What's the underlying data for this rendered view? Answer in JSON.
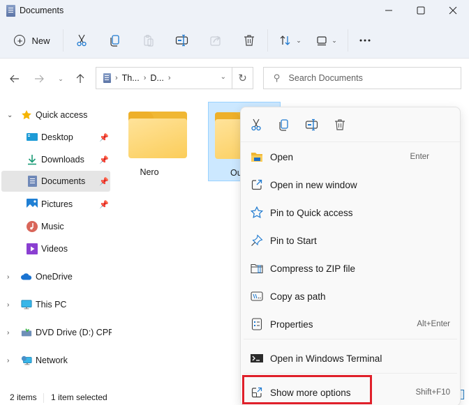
{
  "window": {
    "title": "Documents",
    "controls": {
      "minimize": "minimize-icon",
      "maximize": "maximize-icon",
      "close": "close-icon"
    }
  },
  "toolbar": {
    "new_label": "New",
    "buttons": [
      {
        "name": "cut",
        "icon": "scissors-icon",
        "enabled": true
      },
      {
        "name": "copy",
        "icon": "copy-icon",
        "enabled": true
      },
      {
        "name": "paste",
        "icon": "paste-icon",
        "enabled": false
      },
      {
        "name": "rename",
        "icon": "rename-icon",
        "enabled": true
      },
      {
        "name": "share",
        "icon": "share-icon",
        "enabled": false
      },
      {
        "name": "delete",
        "icon": "trash-icon",
        "enabled": true
      },
      {
        "name": "sort",
        "icon": "sort-icon",
        "has_dropdown": true
      },
      {
        "name": "view",
        "icon": "view-icon",
        "has_dropdown": true
      },
      {
        "name": "more",
        "icon": "more-icon"
      }
    ]
  },
  "navigation": {
    "back": "back-arrow-icon",
    "forward": "forward-arrow-icon",
    "recent": "chevron-down-icon",
    "up": "up-arrow-icon"
  },
  "address": {
    "crumbs": [
      "Th...",
      "D..."
    ]
  },
  "search": {
    "placeholder": "Search Documents"
  },
  "sidebar": {
    "items": [
      {
        "label": "Quick access",
        "expand": "expanded",
        "pinned": false
      },
      {
        "label": "Desktop",
        "pinned": true
      },
      {
        "label": "Downloads",
        "pinned": true
      },
      {
        "label": "Documents",
        "pinned": true,
        "selected": true
      },
      {
        "label": "Pictures",
        "pinned": true
      },
      {
        "label": "Music",
        "pinned": false
      },
      {
        "label": "Videos",
        "pinned": false
      },
      {
        "label": "OneDrive",
        "expand": "collapsed"
      },
      {
        "label": "This PC",
        "expand": "collapsed"
      },
      {
        "label": "DVD Drive (D:) CPRA",
        "expand": "collapsed"
      },
      {
        "label": "Network",
        "expand": "collapsed"
      }
    ]
  },
  "content": {
    "folders": [
      {
        "name": "Nero",
        "selected": false
      },
      {
        "name": "Ou",
        "selected": true
      }
    ]
  },
  "status": {
    "items": "2 items",
    "selected": "1 item selected"
  },
  "context_menu": {
    "quick_actions": [
      "cut",
      "copy",
      "rename",
      "delete"
    ],
    "items": [
      {
        "label": "Open",
        "shortcut": "Enter",
        "icon": "folder-open-icon"
      },
      {
        "label": "Open in new window",
        "shortcut": "",
        "icon": "open-new-window-icon"
      },
      {
        "label": "Pin to Quick access",
        "shortcut": "",
        "icon": "star-icon"
      },
      {
        "label": "Pin to Start",
        "shortcut": "",
        "icon": "pin-icon"
      },
      {
        "label": "Compress to ZIP file",
        "shortcut": "",
        "icon": "zip-icon"
      },
      {
        "label": "Copy as path",
        "shortcut": "",
        "icon": "copy-path-icon"
      },
      {
        "label": "Properties",
        "shortcut": "Alt+Enter",
        "icon": "properties-icon"
      },
      {
        "label": "Open in Windows Terminal",
        "shortcut": "",
        "icon": "terminal-icon"
      },
      {
        "label": "Show more options",
        "shortcut": "Shift+F10",
        "icon": "show-more-icon",
        "highlighted": true
      }
    ]
  },
  "colors": {
    "accent": "#0f6cbd",
    "selection_bg": "#cce8ff",
    "highlight_border": "#e0202a",
    "folder_yellow": "#fbcd5a"
  }
}
